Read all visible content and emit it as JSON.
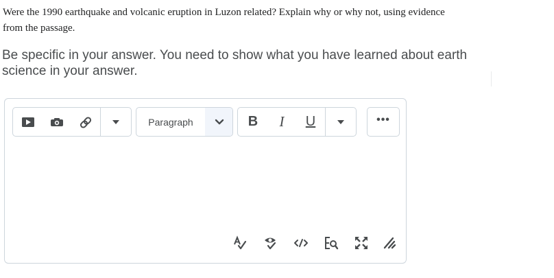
{
  "question": {
    "line1": "Were the 1990 earthquake and volcanic eruption in Luzon related? Explain why or why not, using evidence",
    "line2": "from the passage."
  },
  "instruction": {
    "line1": "Be specific in your answer. You need to show what you have learned about earth",
    "line2": "science in your answer."
  },
  "toolbar": {
    "insert_group": [
      "video-icon",
      "camera-icon",
      "link-icon",
      "chevron-down-icon"
    ],
    "format_select": {
      "value": "Paragraph"
    },
    "text_style": {
      "bold": "B",
      "italic": "I",
      "underline": "U"
    },
    "more": "•••"
  },
  "bottom_tools": [
    "spellcheck-icon",
    "accessibility-check-icon",
    "source-code-icon",
    "preview-icon",
    "fullscreen-icon",
    "resize-handle-icon"
  ],
  "colors": {
    "icon": "#494c4e",
    "border": "#cdd5dc",
    "select_bg": "#f1f5fb"
  }
}
